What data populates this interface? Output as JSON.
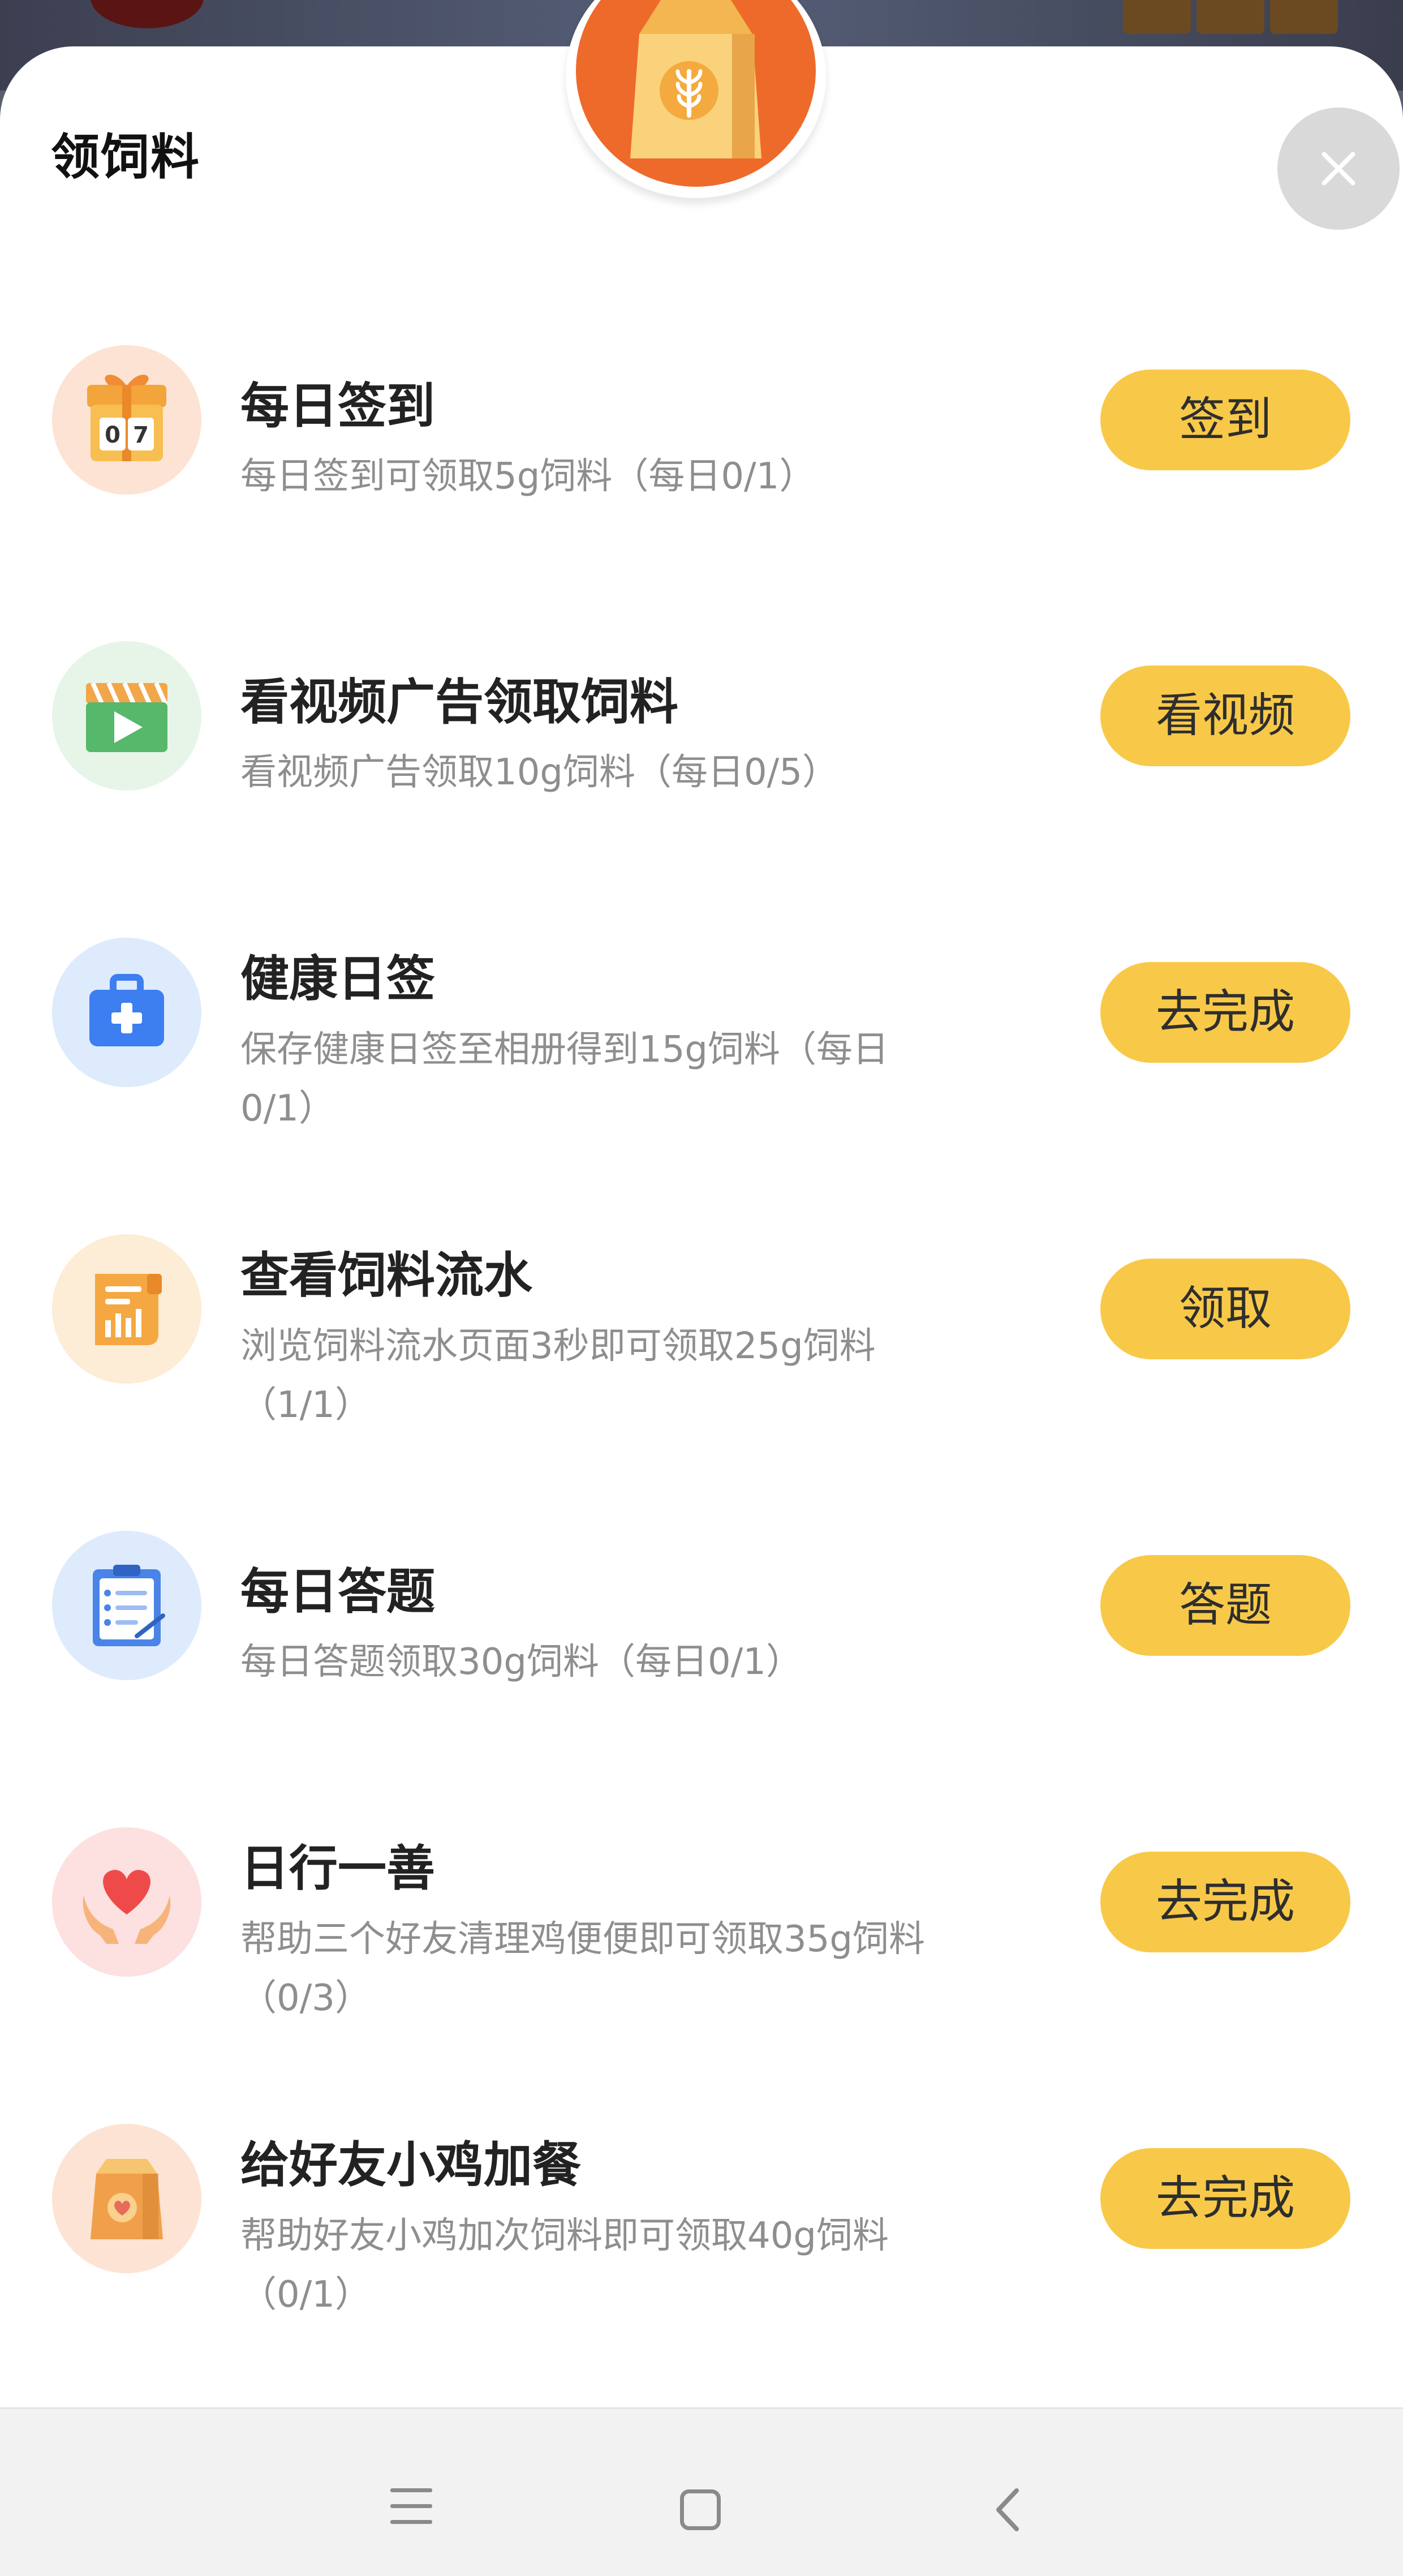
{
  "sheet": {
    "title": "领饲料"
  },
  "colors": {
    "button_bg": "#f8c948",
    "sheet_bg": "#ffffff",
    "title_text": "#222222",
    "desc_text": "#8e8e8e"
  },
  "tasks": [
    {
      "icon": "calendar-gift-icon",
      "title": "每日签到",
      "desc": "每日签到可领取5g饲料（每日0/1）",
      "button": "签到"
    },
    {
      "icon": "video-clapper-icon",
      "title": "看视频广告领取饲料",
      "desc": "看视频广告领取10g饲料（每日0/5）",
      "button": "看视频"
    },
    {
      "icon": "medical-kit-icon",
      "title": "健康日签",
      "desc": "保存健康日签至相册得到15g饲料（每日0/1）",
      "button": "去完成"
    },
    {
      "icon": "receipt-scroll-icon",
      "title": "查看饲料流水",
      "desc": "浏览饲料流水页面3秒即可领取25g饲料（1/1）",
      "button": "领取"
    },
    {
      "icon": "clipboard-quiz-icon",
      "title": "每日答题",
      "desc": "每日答题领取30g饲料（每日0/1）",
      "button": "答题"
    },
    {
      "icon": "heart-hands-icon",
      "title": "日行一善",
      "desc": "帮助三个好友清理鸡便便即可领取35g饲料（0/3）",
      "button": "去完成"
    },
    {
      "icon": "feed-bag-heart-icon",
      "title": "给好友小鸡加餐",
      "desc": "帮助好友小鸡加次饲料即可领取40g饲料（0/1）",
      "button": "去完成"
    }
  ],
  "navbar": {
    "icons": [
      "menu-icon",
      "home-icon",
      "back-icon"
    ]
  }
}
